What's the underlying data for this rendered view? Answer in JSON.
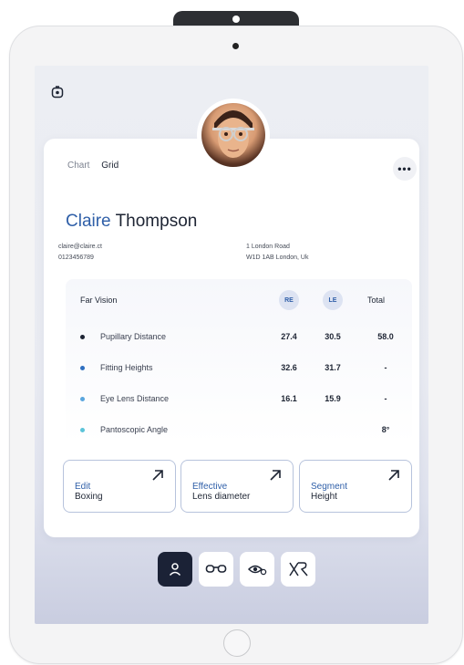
{
  "view_tabs": [
    {
      "label": "Chart",
      "active": false
    },
    {
      "label": "Grid",
      "active": true
    }
  ],
  "more_label": "•••",
  "patient": {
    "first_name": "Claire",
    "last_name": "Thompson",
    "email": "claire@claire.ct",
    "phone": "0123456789",
    "address_line1": "1 London Road",
    "address_line2": "W1D 1AB London, Uk"
  },
  "vision": {
    "title": "Far Vision",
    "re_label": "RE",
    "le_label": "LE",
    "total_label": "Total",
    "rows": [
      {
        "label": "Pupillary Distance",
        "re": "27.4",
        "le": "30.5",
        "total": "58.0",
        "dot_color": "#1d2433"
      },
      {
        "label": "Fitting Heights",
        "re": "32.6",
        "le": "31.7",
        "total": "-",
        "dot_color": "#2f6fc0"
      },
      {
        "label": "Eye Lens Distance",
        "re": "16.1",
        "le": "15.9",
        "total": "-",
        "dot_color": "#5aa6de"
      },
      {
        "label": "Pantoscopic Angle",
        "re": "",
        "le": "",
        "total": "8°",
        "dot_color": "#5cc4d9"
      }
    ]
  },
  "actions": [
    {
      "line1": "Edit",
      "line2": "Boxing"
    },
    {
      "line1": "Effective",
      "line2": "Lens diameter"
    },
    {
      "line1": "Segment",
      "line2": "Height"
    }
  ],
  "nav": [
    "person-icon",
    "glasses-icon",
    "eye-settings-icon",
    "xr-logo-icon"
  ],
  "colors": {
    "accent": "#2f5fa8",
    "nav_active": "#1b2236"
  }
}
